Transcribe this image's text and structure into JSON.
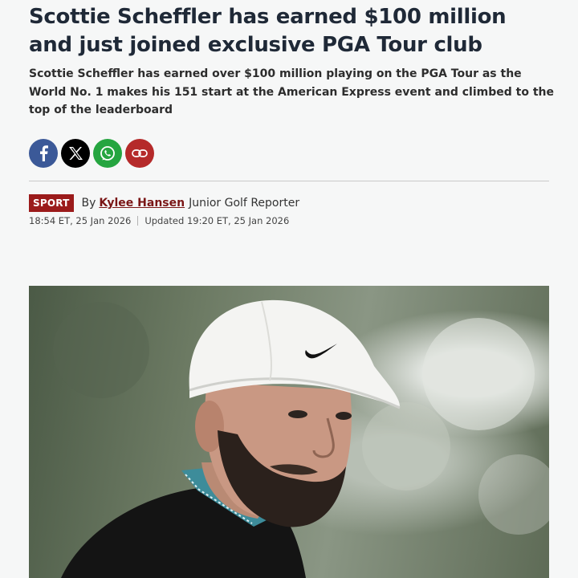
{
  "article": {
    "headline": "Scottie Scheffler has earned $100 million and just joined exclusive PGA Tour club",
    "standfirst": "Scottie Scheffler has earned over $100 million playing on the PGA Tour as the World No. 1 makes his 151 start at the American Express event and climbed to the top of the leaderboard",
    "section": "SPORT",
    "by": "By",
    "author": "Kylee Hansen",
    "author_role": "Junior Golf Reporter",
    "published": "18:54 ET, 25 Jan 2026",
    "updated": "Updated 19:20 ET, 25 Jan 2026"
  },
  "share": [
    {
      "network": "facebook",
      "icon": "facebook-icon",
      "color": "#3b5998"
    },
    {
      "network": "x",
      "icon": "x-icon",
      "color": "#000000"
    },
    {
      "network": "whatsapp",
      "icon": "whatsapp-icon",
      "color": "#25a540"
    },
    {
      "network": "link",
      "icon": "link-icon",
      "color": "#b52a2a"
    }
  ],
  "colors": {
    "section_badge": "#9b1b1b",
    "author_link": "#7a1616"
  }
}
